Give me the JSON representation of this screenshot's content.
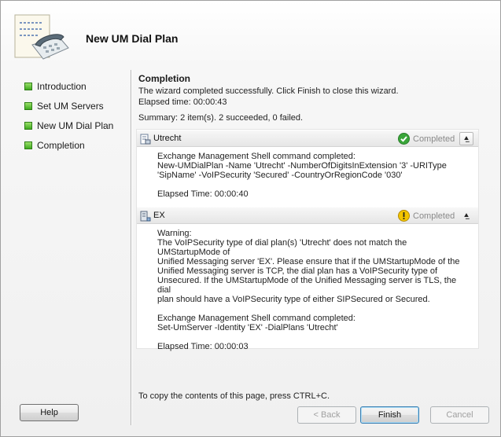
{
  "window": {
    "title": "New UM Dial Plan"
  },
  "nav": {
    "items": [
      {
        "label": "Introduction"
      },
      {
        "label": "Set UM Servers"
      },
      {
        "label": "New UM Dial Plan"
      },
      {
        "label": "Completion"
      }
    ]
  },
  "main": {
    "title": "Completion",
    "message": "The wizard completed successfully. Click Finish to close this wizard.",
    "elapsed": "Elapsed time: 00:00:43",
    "summary": "Summary: 2 item(s). 2 succeeded, 0 failed."
  },
  "results": [
    {
      "name": "Utrecht",
      "status": "Completed",
      "status_type": "success",
      "icon": "dialplan-icon",
      "body": [
        "Exchange Management Shell command completed:",
        "New-UMDialPlan -Name 'Utrecht' -NumberOfDigitsInExtension '3' -URIType",
        "'SipName' -VoIPSecurity 'Secured' -CountryOrRegionCode '030'",
        "",
        "Elapsed Time: 00:00:40"
      ]
    },
    {
      "name": "EX",
      "status": "Completed",
      "status_type": "warning",
      "icon": "server-icon",
      "body": [
        "Warning:",
        "The VoIPSecurity type of dial plan(s) 'Utrecht' does not match the UMStartupMode of",
        "Unified Messaging server 'EX'. Please ensure that if the UMStartupMode of the",
        "Unified Messaging server is TCP, the dial plan has a VoIPSecurity type of",
        "Unsecured. If the UMStartupMode of the Unified Messaging server is TLS, the dial",
        "plan should have a VoIPSecurity type of either SIPSecured or Secured.",
        "",
        "Exchange Management Shell command completed:",
        "Set-UmServer -Identity 'EX' -DialPlans 'Utrecht'",
        "",
        "Elapsed Time: 00:00:03"
      ]
    }
  ],
  "footer": {
    "copy_hint": "To copy the contents of this page, press CTRL+C.",
    "help_label": "Help",
    "back_label": "< Back",
    "finish_label": "Finish",
    "cancel_label": "Cancel"
  },
  "colors": {
    "nav_bullet": "#4cb82a",
    "success": "#3aa63a",
    "warning": "#e8b400",
    "status_text": "#8a8a8a"
  }
}
